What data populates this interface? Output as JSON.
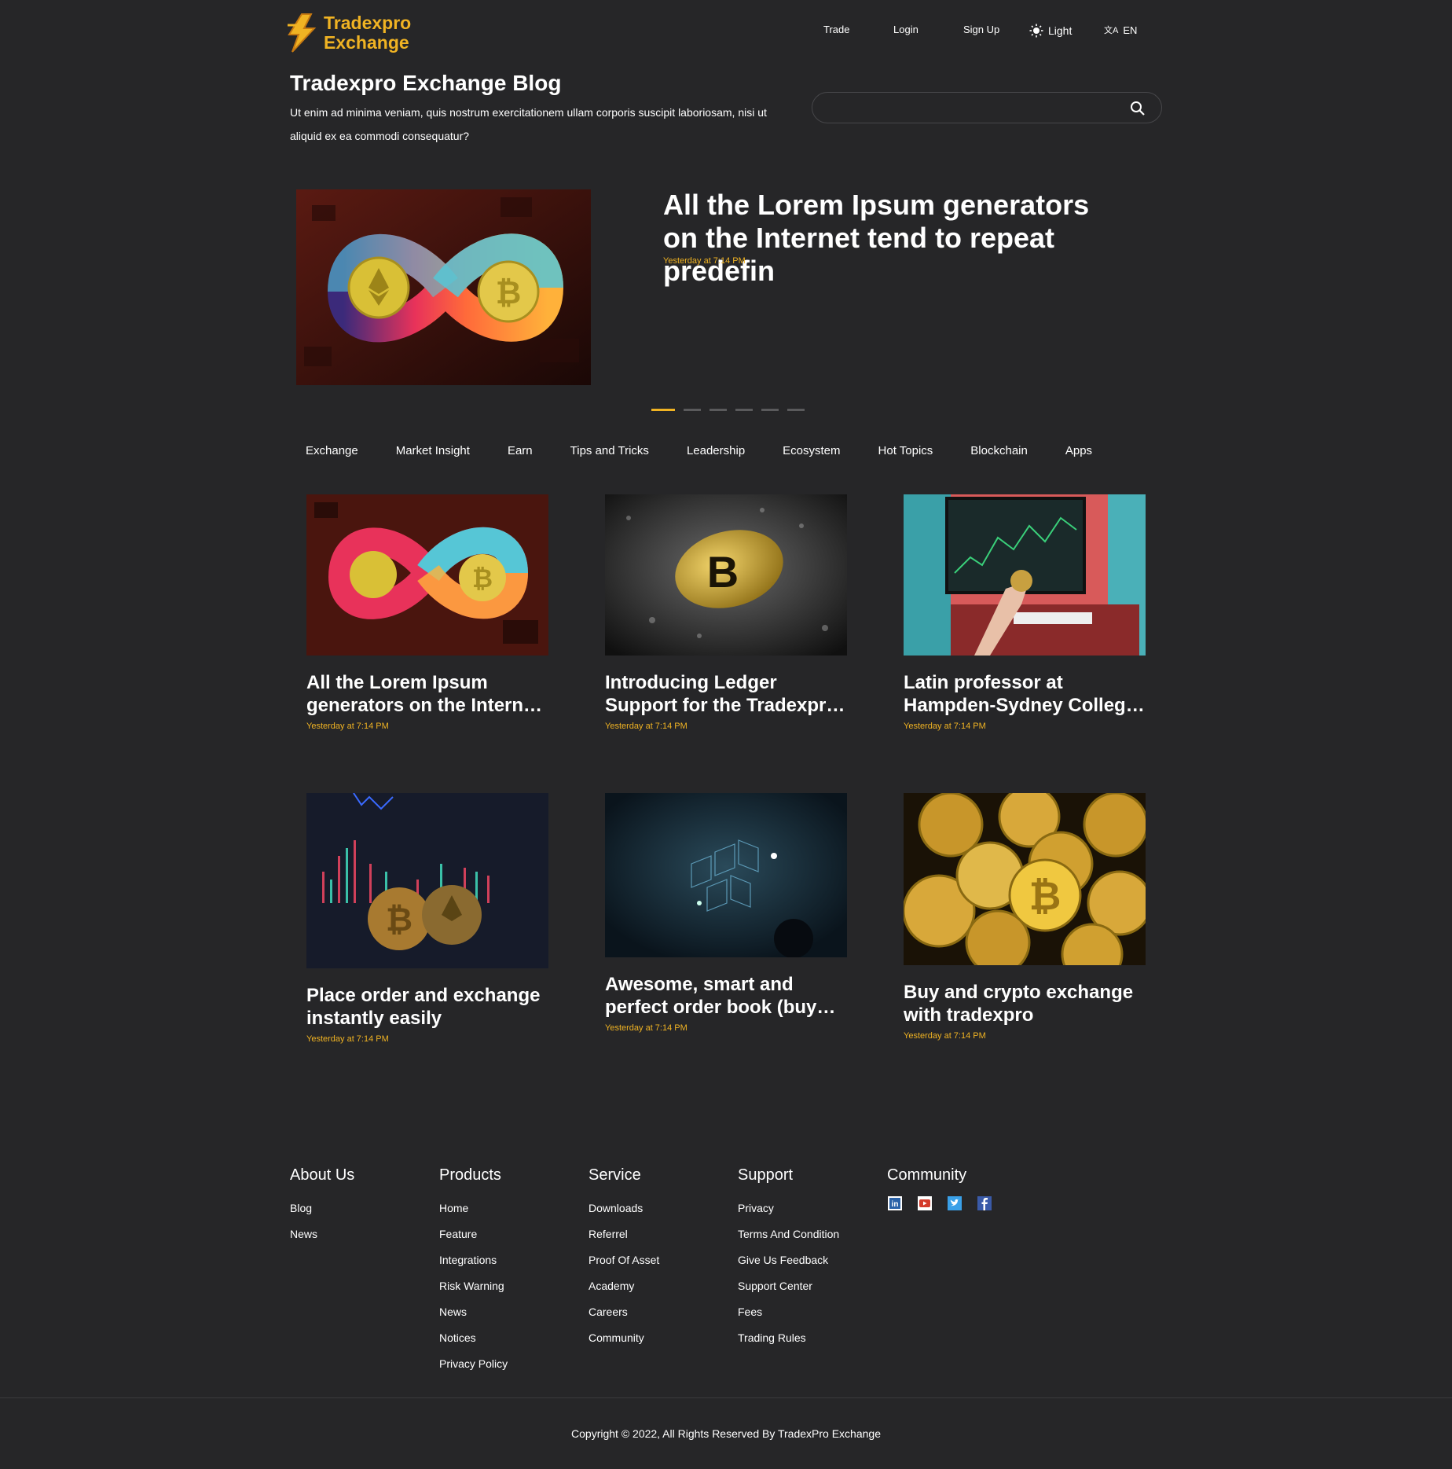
{
  "header": {
    "logo_line1": "Tradexpro",
    "logo_line2": "Exchange",
    "nav": {
      "trade": "Trade",
      "login": "Login",
      "signup": "Sign Up",
      "theme": "Light",
      "language": "EN"
    }
  },
  "blog": {
    "title": "Tradexpro Exchange Blog",
    "subtitle": "Ut enim ad minima veniam, quis nostrum exercitationem ullam corporis suscipit laboriosam, nisi ut aliquid ex ea commodi consequatur?",
    "search_placeholder": ""
  },
  "hero": {
    "title": "All the Lorem Ipsum generators on the Internet tend to repeat predefin",
    "time": "Yesterday at 7:14 PM",
    "slide_count": 6,
    "active_slide": 1
  },
  "categories": [
    "Exchange",
    "Market Insight",
    "Earn",
    "Tips and Tricks",
    "Leadership",
    "Ecosystem",
    "Hot Topics",
    "Blockchain",
    "Apps"
  ],
  "posts": [
    {
      "title": "All the Lorem Ipsum generators on the Internet tend to repeat",
      "time": "Yesterday at 7:14 PM",
      "image": "infinity-crypto-image"
    },
    {
      "title": "Introducing Ledger Support for the Tradexpro Exchange",
      "time": "Yesterday at 7:14 PM",
      "image": "bitcoin-gravel-image"
    },
    {
      "title": "Latin professor at Hampden-Sydney College in Virginia",
      "time": "Yesterday at 7:14 PM",
      "image": "bitcoin-hand-monitor-image"
    },
    {
      "title": "Place order and exchange instantly easily",
      "time": "Yesterday at 7:14 PM",
      "image": "coins-chart-image"
    },
    {
      "title": "Awesome, smart and perfect order book (buy and sell)",
      "time": "Yesterday at 7:14 PM",
      "image": "blockchain-network-image"
    },
    {
      "title": "Buy and crypto exchange with tradexpro",
      "time": "Yesterday at 7:14 PM",
      "image": "gold-coins-image"
    }
  ],
  "footer": {
    "about": {
      "heading": "About Us",
      "links": [
        "Blog",
        "News"
      ]
    },
    "products": {
      "heading": "Products",
      "links": [
        "Home",
        "Feature",
        "Integrations",
        "Risk Warning",
        "News",
        "Notices",
        "Privacy Policy"
      ]
    },
    "service": {
      "heading": "Service",
      "links": [
        "Downloads",
        "Referrel",
        "Proof Of Asset",
        "Academy",
        "Careers",
        "Community"
      ]
    },
    "support": {
      "heading": "Support",
      "links": [
        "Privacy",
        "Terms And Condition",
        "Give Us Feedback",
        "Support Center",
        "Fees",
        "Trading Rules"
      ]
    },
    "community": {
      "heading": "Community",
      "icons": [
        "linkedin-icon",
        "youtube-icon",
        "twitter-icon",
        "facebook-icon"
      ]
    },
    "copyright": "Copyright © 2022, All Rights Reserved By TradexPro Exchange"
  },
  "colors": {
    "background": "#262628",
    "accent": "#f0b323",
    "text": "#ffffff"
  }
}
